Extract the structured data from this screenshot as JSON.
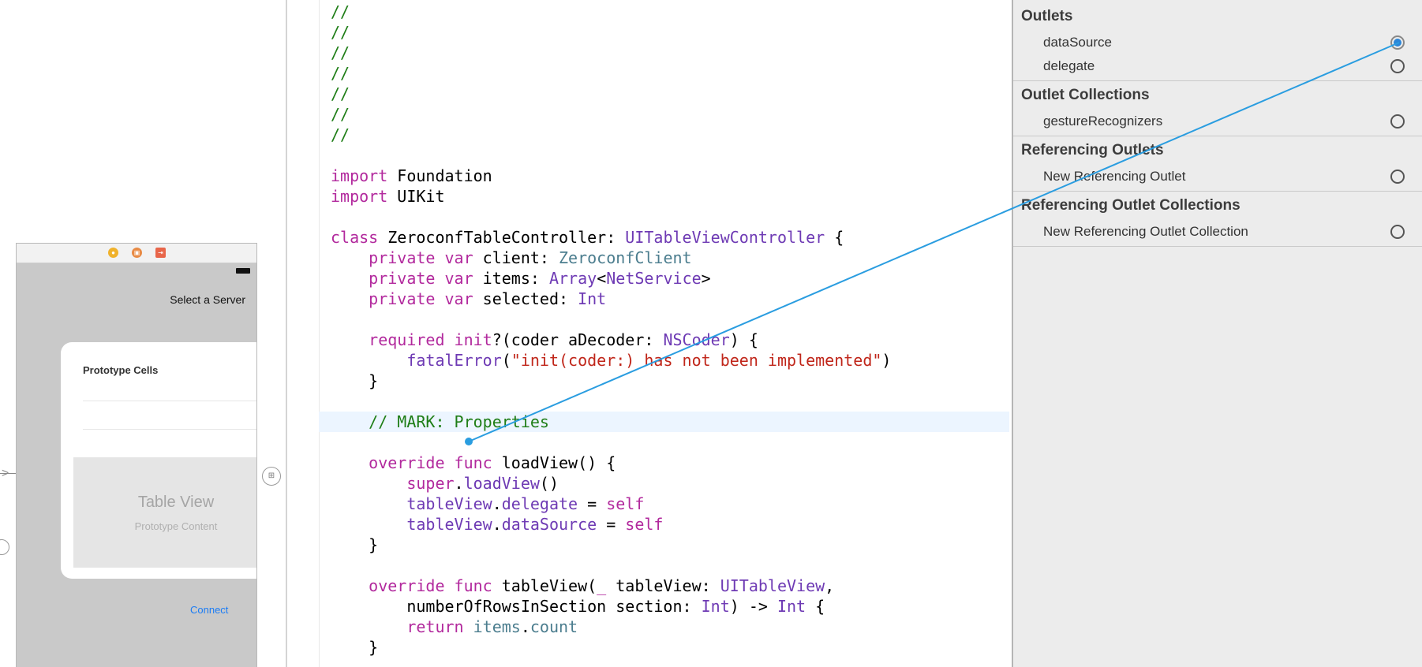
{
  "storyboard": {
    "nav_title": "Select a Server",
    "prototype_cells_label": "Prototype Cells",
    "table_view_title": "Table View",
    "table_view_subtitle": "Prototype Content",
    "connect_label": "Connect",
    "dock_icons": [
      "view-controller-icon",
      "first-responder-icon",
      "exit-icon"
    ]
  },
  "editor": {
    "lines": [
      {
        "tokens": [
          {
            "c": "cm",
            "t": "//"
          }
        ]
      },
      {
        "tokens": [
          {
            "c": "cm",
            "t": "//"
          }
        ]
      },
      {
        "tokens": [
          {
            "c": "cm",
            "t": "//"
          }
        ]
      },
      {
        "tokens": [
          {
            "c": "cm",
            "t": "//"
          }
        ]
      },
      {
        "tokens": [
          {
            "c": "cm",
            "t": "//"
          }
        ]
      },
      {
        "tokens": [
          {
            "c": "cm",
            "t": "//"
          }
        ]
      },
      {
        "tokens": [
          {
            "c": "cm",
            "t": "//"
          }
        ]
      },
      {
        "tokens": []
      },
      {
        "tokens": [
          {
            "c": "kw",
            "t": "import"
          },
          {
            "c": "pl",
            "t": " Foundation"
          }
        ]
      },
      {
        "tokens": [
          {
            "c": "kw",
            "t": "import"
          },
          {
            "c": "pl",
            "t": " UIKit"
          }
        ]
      },
      {
        "tokens": []
      },
      {
        "tokens": [
          {
            "c": "kw",
            "t": "class"
          },
          {
            "c": "pl",
            "t": " ZeroconfTableController: "
          },
          {
            "c": "ty",
            "t": "UITableViewController"
          },
          {
            "c": "pl",
            "t": " {"
          }
        ]
      },
      {
        "tokens": [
          {
            "c": "pl",
            "t": "    "
          },
          {
            "c": "kw",
            "t": "private"
          },
          {
            "c": "pl",
            "t": " "
          },
          {
            "c": "kw",
            "t": "var"
          },
          {
            "c": "pl",
            "t": " client: "
          },
          {
            "c": "pr",
            "t": "ZeroconfClient"
          }
        ]
      },
      {
        "tokens": [
          {
            "c": "pl",
            "t": "    "
          },
          {
            "c": "kw",
            "t": "private"
          },
          {
            "c": "pl",
            "t": " "
          },
          {
            "c": "kw",
            "t": "var"
          },
          {
            "c": "pl",
            "t": " items: "
          },
          {
            "c": "ty",
            "t": "Array"
          },
          {
            "c": "pl",
            "t": "<"
          },
          {
            "c": "ty",
            "t": "NetService"
          },
          {
            "c": "pl",
            "t": ">"
          }
        ]
      },
      {
        "tokens": [
          {
            "c": "pl",
            "t": "    "
          },
          {
            "c": "kw",
            "t": "private"
          },
          {
            "c": "pl",
            "t": " "
          },
          {
            "c": "kw",
            "t": "var"
          },
          {
            "c": "pl",
            "t": " selected: "
          },
          {
            "c": "ty",
            "t": "Int"
          }
        ]
      },
      {
        "tokens": []
      },
      {
        "tokens": [
          {
            "c": "pl",
            "t": "    "
          },
          {
            "c": "kw",
            "t": "required"
          },
          {
            "c": "pl",
            "t": " "
          },
          {
            "c": "kw",
            "t": "init"
          },
          {
            "c": "pl",
            "t": "?(coder aDecoder: "
          },
          {
            "c": "ty",
            "t": "NSCoder"
          },
          {
            "c": "pl",
            "t": ") {"
          }
        ]
      },
      {
        "tokens": [
          {
            "c": "pl",
            "t": "        "
          },
          {
            "c": "ty",
            "t": "fatalError"
          },
          {
            "c": "pl",
            "t": "("
          },
          {
            "c": "st",
            "t": "\"init(coder:) has not been implemented\""
          },
          {
            "c": "pl",
            "t": ")"
          }
        ]
      },
      {
        "tokens": [
          {
            "c": "pl",
            "t": "    }"
          }
        ]
      },
      {
        "tokens": []
      },
      {
        "hl": true,
        "tokens": [
          {
            "c": "cm",
            "t": "    // MARK: Properties"
          }
        ]
      },
      {
        "tokens": []
      },
      {
        "tokens": [
          {
            "c": "pl",
            "t": "    "
          },
          {
            "c": "kw",
            "t": "override"
          },
          {
            "c": "pl",
            "t": " "
          },
          {
            "c": "kw",
            "t": "func"
          },
          {
            "c": "pl",
            "t": " loadView() {"
          }
        ]
      },
      {
        "tokens": [
          {
            "c": "pl",
            "t": "        "
          },
          {
            "c": "kw",
            "t": "super"
          },
          {
            "c": "pl",
            "t": "."
          },
          {
            "c": "ty",
            "t": "loadView"
          },
          {
            "c": "pl",
            "t": "()"
          }
        ]
      },
      {
        "tokens": [
          {
            "c": "pl",
            "t": "        "
          },
          {
            "c": "ty",
            "t": "tableView"
          },
          {
            "c": "pl",
            "t": "."
          },
          {
            "c": "ty",
            "t": "delegate"
          },
          {
            "c": "pl",
            "t": " = "
          },
          {
            "c": "kw",
            "t": "self"
          }
        ]
      },
      {
        "tokens": [
          {
            "c": "pl",
            "t": "        "
          },
          {
            "c": "ty",
            "t": "tableView"
          },
          {
            "c": "pl",
            "t": "."
          },
          {
            "c": "ty",
            "t": "dataSource"
          },
          {
            "c": "pl",
            "t": " = "
          },
          {
            "c": "kw",
            "t": "self"
          }
        ]
      },
      {
        "tokens": [
          {
            "c": "pl",
            "t": "    }"
          }
        ]
      },
      {
        "tokens": []
      },
      {
        "tokens": [
          {
            "c": "pl",
            "t": "    "
          },
          {
            "c": "kw",
            "t": "override"
          },
          {
            "c": "pl",
            "t": " "
          },
          {
            "c": "kw",
            "t": "func"
          },
          {
            "c": "pl",
            "t": " tableView("
          },
          {
            "c": "kw",
            "t": "_"
          },
          {
            "c": "pl",
            "t": " tableView: "
          },
          {
            "c": "ty",
            "t": "UITableView"
          },
          {
            "c": "pl",
            "t": ","
          }
        ]
      },
      {
        "tokens": [
          {
            "c": "pl",
            "t": "        numberOfRowsInSection section: "
          },
          {
            "c": "ty",
            "t": "Int"
          },
          {
            "c": "pl",
            "t": ") -> "
          },
          {
            "c": "ty",
            "t": "Int"
          },
          {
            "c": "pl",
            "t": " {"
          }
        ]
      },
      {
        "tokens": [
          {
            "c": "pl",
            "t": "        "
          },
          {
            "c": "kw",
            "t": "return"
          },
          {
            "c": "pl",
            "t": " "
          },
          {
            "c": "pr",
            "t": "items"
          },
          {
            "c": "pl",
            "t": "."
          },
          {
            "c": "pr",
            "t": "count"
          }
        ]
      },
      {
        "tokens": [
          {
            "c": "pl",
            "t": "    }"
          }
        ]
      }
    ]
  },
  "inspector": {
    "outlets_header": "Outlets",
    "outlets": [
      "dataSource",
      "delegate"
    ],
    "outlet_collections_header": "Outlet Collections",
    "outlet_collections": [
      "gestureRecognizers"
    ],
    "referencing_outlets_header": "Referencing Outlets",
    "referencing_outlets": [
      "New Referencing Outlet"
    ],
    "referencing_outlet_collections_header": "Referencing Outlet Collections",
    "referencing_outlet_collections": [
      "New Referencing Outlet Collection"
    ]
  },
  "colors": {
    "comment": "#1f7e17",
    "keyword": "#b2299d",
    "type": "#6e3ab4",
    "string": "#c0261a",
    "connection_line": "#2a9de0"
  }
}
